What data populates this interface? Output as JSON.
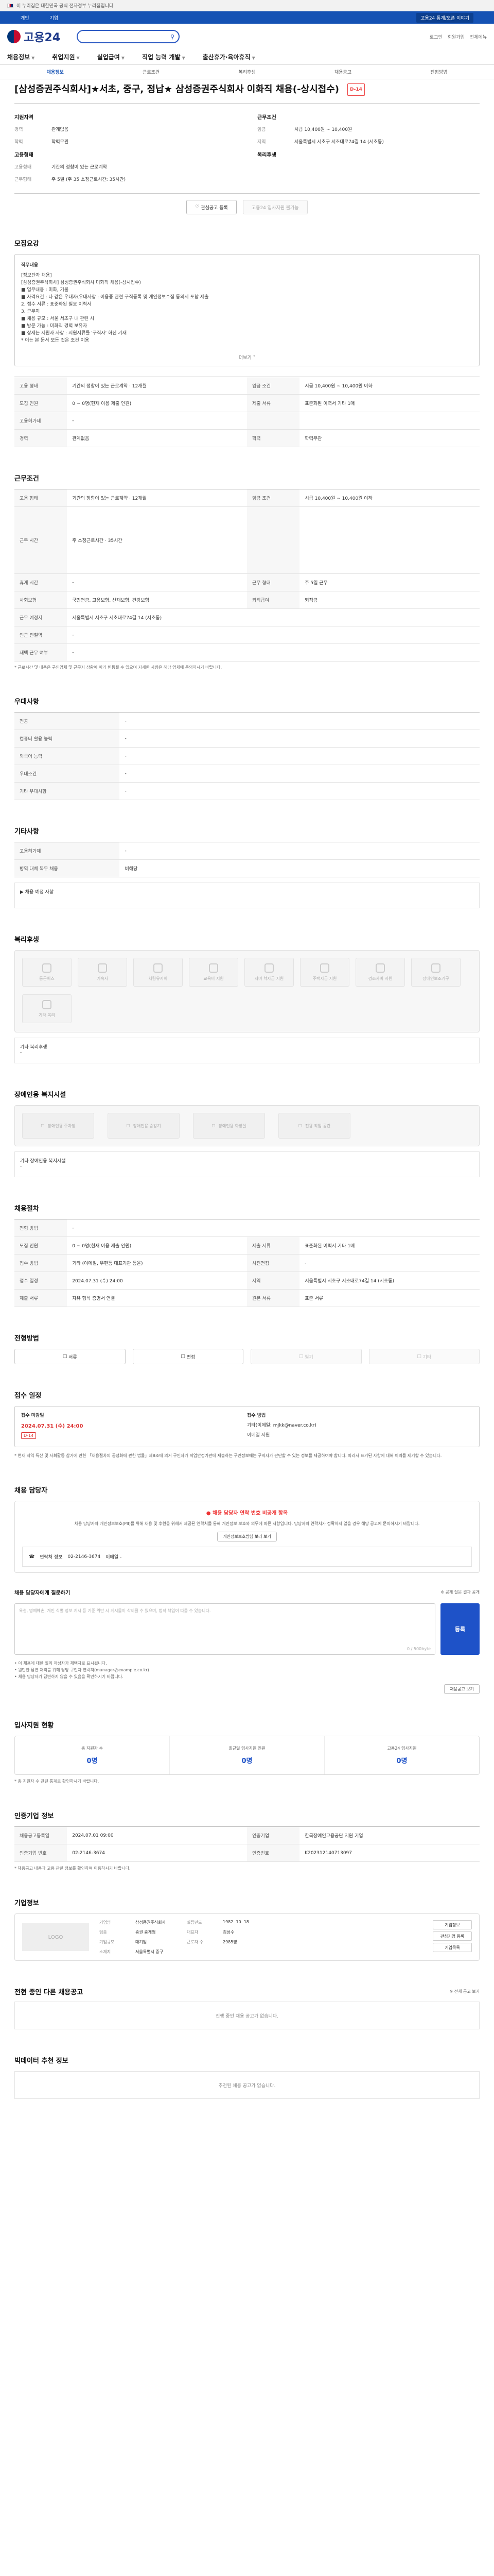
{
  "gov_bar": {
    "text": "이 누리집은 대한민국 공식 전자정부 누리집입니다."
  },
  "sub_bar": {
    "links": [
      "개인",
      "기업"
    ],
    "right": "고용24 통계/오픈 이야기"
  },
  "header": {
    "logo": "고용24",
    "links": [
      "로그인",
      "회원가입",
      "전체메뉴"
    ]
  },
  "gnb": [
    "채용정보",
    "취업지원",
    "실업급여",
    "직업 능력 개발",
    "출산휴가·육아휴직"
  ],
  "lnb": [
    "채용정보",
    "근로조건",
    "복리후생",
    "채용공고",
    "전형방법"
  ],
  "job": {
    "title": "[삼성증권주식회사]★서초, 중구, 정납★ 삼성증권주식회사 이화직 채용(-상시접수)",
    "tag": "D-14",
    "left_head": "지원자격",
    "left_rows": [
      {
        "k": "경력",
        "v": "관계없음"
      },
      {
        "k": "학력",
        "v": "학력무관"
      }
    ],
    "left_head2": "고용형태",
    "left_rows2": [
      {
        "k": "고용형태",
        "v": "기간의 정함이 있는 근로계약"
      },
      {
        "k": "근무형태",
        "v": "주 5일 (주 35 소정근로시간: 35시간)"
      }
    ],
    "right_head": "근무조건",
    "right_rows": [
      {
        "k": "임금",
        "v": "시급 10,400원 ~ 10,400원"
      },
      {
        "k": "지역",
        "v": "서울특별시 서초구 서초대로74길 14 (서초동)"
      }
    ],
    "right_head2": "복리후생",
    "btn_interest": "관심공고 등록",
    "btn_apply": "고용24 입사지원 불가능"
  },
  "desc": {
    "title": "모집요강",
    "lines": [
      "직무내용",
      "[정보단자 채용]",
      "[삼성증권주식회사] 삼성증권주식회사 미화직 채용(-상시접수)",
      "■ 업무내용 : 미화, 기물",
      "■ 자격요건 : 나 같은 우대자(우대사항 : 이용중 관련 구직등록 및 개인정보수집 동의서 포함 제출",
      "2. 접수 서류 : 표준화된 필요 이력서",
      "3. 근무지",
      "■ 채용 규모 : 서울 서초구 내 관련 시",
      "■ 방문 가능 : 미화직 경력 보유자",
      "■ 상세는 지원자 사항 : 지원서류를 '구직자' 하신 기재",
      "  * 이는 본 문서 모든 것은 조건 이용"
    ],
    "more": "더보기"
  },
  "cond": {
    "title": "근무조건",
    "rows": [
      [
        "고용 형태",
        "기간의 정함이 있는 근로계약 · 12개월",
        "임금 조건",
        "시급 10,400원 ~ 10,400원 이하"
      ],
      [
        "근무 시간",
        "주 소정근로시간 · 35시간",
        "",
        ""
      ],
      [
        "휴게 시간",
        "-",
        "근무 형태",
        "주 5일 근무"
      ],
      [
        "사회보험",
        "국민연금, 고용보험, 산재보험, 건강보험",
        "퇴직급여",
        "퇴직금"
      ],
      [
        "근무 예정지",
        "서울특별시 서초구 서초대로74길 14 (서초동)",
        "",
        ""
      ],
      [
        "인근 전철역",
        "-",
        "",
        ""
      ],
      [
        "재택 근무 여부",
        "-",
        "",
        ""
      ]
    ],
    "note": "* 근로시간 및 내용은 구인업체 및 근무지 상황에 따라 변동될 수 있으며 자세한 사항은 해당 업체에 문의하시기 바랍니다."
  },
  "qual": {
    "title": "우대사항",
    "rows": [
      [
        "전공",
        "-"
      ],
      [
        "컴퓨터 활용 능력",
        "-"
      ],
      [
        "외국어 능력",
        "-"
      ],
      [
        "우대조건",
        "-"
      ],
      [
        "기타 우대사항",
        "-"
      ]
    ]
  },
  "etc": {
    "title": "기타사항",
    "rows": [
      [
        "고용허가제",
        "-"
      ],
      [
        "병역 대체 복무 채용",
        "비해당"
      ]
    ],
    "extra_label": "▶ 채용 예정 사항"
  },
  "welfare": {
    "title": "복리후생",
    "items": [
      "통근버스",
      "기숙사",
      "차량유지비",
      "교육비 지원",
      "자녀 학자금 지원",
      "주택자금 지원",
      "경조사비 지원",
      "장애인보조기구",
      "기타 복리"
    ],
    "other_label": "기타 복리후생",
    "other_value": "-"
  },
  "disabled": {
    "title": "장애인용 복지시설",
    "items": [
      "장애인용 주차장",
      "장애인용 승강기",
      "장애인용 화장실",
      "전용 작업 공간"
    ],
    "other_label": "기타 장애인용 복지시설",
    "other_value": "-"
  },
  "hire": {
    "title": "채용절차",
    "rows": [
      [
        "전형 방법",
        "-",
        "",
        ""
      ],
      [
        "모집 인원",
        "0 ~ 0명(현재 이용 제출 인원)",
        "제출 서류",
        "표준화된 이력서 기타 1매"
      ],
      [
        "접수 방법",
        "기타 (이메일, 우편등 대표기관 등을)",
        "사전면접",
        "-"
      ],
      [
        "접수 일정",
        "2024.07.31 (수) 24:00",
        "지역",
        "서울특별시 서초구 서초대로74길 14 (서초동)"
      ],
      [
        "제출 서류",
        "자유 형식 증명서 연결",
        "원본 서류",
        "표준 서류"
      ]
    ]
  },
  "stage": {
    "title": "전형방법",
    "items": [
      "서류",
      "면접",
      "필기",
      "기타"
    ]
  },
  "apply": {
    "title": "접수 일정",
    "period_h": "접수 마감일",
    "date": "2024.07.31 (수) 24:00",
    "dday": "D-14",
    "method_h": "접수 방법",
    "method": "기타(이메일: mjkk@naver.co.kr)",
    "others": "이메일 지원",
    "hint": "* 현재 지역 특산 및 사회활동 참가에 관한 「채용절차의 공정화에 관한 법률」제8조에 의거 구인자가 직업안정기관에 제출하는 구인정보에는 구직자가 판단할 수 있는 정보를 제공하여야 합니다. 따라서 표기된 사항에 대해 이의를 제기할 수 있습니다."
  },
  "contact": {
    "title": "채용 담당자",
    "warn": "● 채용 담당자 연락 번호 비공개 항목",
    "desc": "채용 담당자와 개인정보보호(PII)를 위해 채용 및 후원을 위해서 제공된 연락처를 통해 개인정보 보호와 의무에 따른 사항입니다. 담당자의 연락처가 정확하지 않을 경우 해당 공고에 문의하시기 바랍니다.",
    "pill": "개인정보보호방침 보러 보기",
    "tel_label": "연락처 정보",
    "tel": "02-2146-3674",
    "fax": "이메일 -"
  },
  "qna": {
    "title": "채용 담당자에게 질문하기",
    "right": "※ 공개 질문 결과 공개",
    "placeholder": "욕설, 명예훼손, 개인 식별 정보 게시 등 기준 위반 시 게시물이 삭제될 수 있으며, 법적 책임이 따를 수 있습니다.",
    "count": "0 / 500byte",
    "submit": "등록",
    "notes": [
      "• 이 채용에 대한 질의 작성자가 채택자로 표시됩니다.",
      "• 원만한 답변 처리를 위해 담당 구인자 연락처(manager@example.co.kr)",
      "• 채용 담당자가 답변하지 않을 수 있음을 확인하시기 바랍니다."
    ],
    "pill": "채용공고 보기"
  },
  "stats": {
    "title": "입사지원 현황",
    "items": [
      {
        "l": "총 지원자 수",
        "n": "0명"
      },
      {
        "l": "최근일 입사지원 인원",
        "n": "0명"
      },
      {
        "l": "고용24 입사지원",
        "n": "0명"
      }
    ],
    "note": "* 총 지원자 수 관련 통계로 확인하시기 바랍니다."
  },
  "reg": {
    "title": "인증기업 정보",
    "rows": [
      [
        "채용공고등록일",
        "2024.07.01 09:00",
        "인증기업",
        "한국장애인고용공단 지원 기업"
      ],
      [
        "인증기업 번호",
        "02-2146-3674",
        "인증번호",
        "K202312140713097"
      ]
    ],
    "note": "* 채용공고 내용과 고용 관련 정보를 확인하여 이용하시기 바랍니다."
  },
  "corp": {
    "title": "기업정보",
    "logo": "LOGO",
    "grid": [
      [
        "기업명",
        "삼성증권주식회사",
        "설립년도",
        "1982. 10. 18"
      ],
      [
        "업종",
        "증권 중개업",
        "대표자",
        "김성수"
      ],
      [
        "기업규모",
        "대기업",
        "근로자 수",
        "2985명"
      ],
      [
        "소재지",
        "서울특별시 중구",
        "",
        ""
      ]
    ],
    "btn1": "기업정보",
    "btn2": "관심기업 등록",
    "btn3": "기업목록"
  },
  "same": {
    "title": "전현 중인 다른 채용공고",
    "right": "※ 전체 공고 보기",
    "empty": "진행 중인 채용 공고가 없습니다."
  },
  "rec": {
    "title": "빅데이터 추천 정보",
    "empty": "추천된 채용 공고가 없습니다."
  }
}
